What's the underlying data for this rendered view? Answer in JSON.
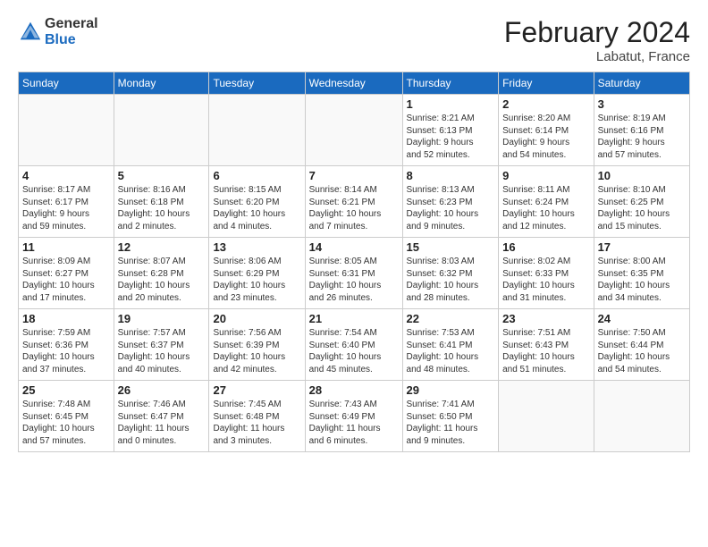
{
  "logo": {
    "general": "General",
    "blue": "Blue"
  },
  "title": "February 2024",
  "location": "Labatut, France",
  "days_header": [
    "Sunday",
    "Monday",
    "Tuesday",
    "Wednesday",
    "Thursday",
    "Friday",
    "Saturday"
  ],
  "weeks": [
    [
      {
        "num": "",
        "info": ""
      },
      {
        "num": "",
        "info": ""
      },
      {
        "num": "",
        "info": ""
      },
      {
        "num": "",
        "info": ""
      },
      {
        "num": "1",
        "info": "Sunrise: 8:21 AM\nSunset: 6:13 PM\nDaylight: 9 hours\nand 52 minutes."
      },
      {
        "num": "2",
        "info": "Sunrise: 8:20 AM\nSunset: 6:14 PM\nDaylight: 9 hours\nand 54 minutes."
      },
      {
        "num": "3",
        "info": "Sunrise: 8:19 AM\nSunset: 6:16 PM\nDaylight: 9 hours\nand 57 minutes."
      }
    ],
    [
      {
        "num": "4",
        "info": "Sunrise: 8:17 AM\nSunset: 6:17 PM\nDaylight: 9 hours\nand 59 minutes."
      },
      {
        "num": "5",
        "info": "Sunrise: 8:16 AM\nSunset: 6:18 PM\nDaylight: 10 hours\nand 2 minutes."
      },
      {
        "num": "6",
        "info": "Sunrise: 8:15 AM\nSunset: 6:20 PM\nDaylight: 10 hours\nand 4 minutes."
      },
      {
        "num": "7",
        "info": "Sunrise: 8:14 AM\nSunset: 6:21 PM\nDaylight: 10 hours\nand 7 minutes."
      },
      {
        "num": "8",
        "info": "Sunrise: 8:13 AM\nSunset: 6:23 PM\nDaylight: 10 hours\nand 9 minutes."
      },
      {
        "num": "9",
        "info": "Sunrise: 8:11 AM\nSunset: 6:24 PM\nDaylight: 10 hours\nand 12 minutes."
      },
      {
        "num": "10",
        "info": "Sunrise: 8:10 AM\nSunset: 6:25 PM\nDaylight: 10 hours\nand 15 minutes."
      }
    ],
    [
      {
        "num": "11",
        "info": "Sunrise: 8:09 AM\nSunset: 6:27 PM\nDaylight: 10 hours\nand 17 minutes."
      },
      {
        "num": "12",
        "info": "Sunrise: 8:07 AM\nSunset: 6:28 PM\nDaylight: 10 hours\nand 20 minutes."
      },
      {
        "num": "13",
        "info": "Sunrise: 8:06 AM\nSunset: 6:29 PM\nDaylight: 10 hours\nand 23 minutes."
      },
      {
        "num": "14",
        "info": "Sunrise: 8:05 AM\nSunset: 6:31 PM\nDaylight: 10 hours\nand 26 minutes."
      },
      {
        "num": "15",
        "info": "Sunrise: 8:03 AM\nSunset: 6:32 PM\nDaylight: 10 hours\nand 28 minutes."
      },
      {
        "num": "16",
        "info": "Sunrise: 8:02 AM\nSunset: 6:33 PM\nDaylight: 10 hours\nand 31 minutes."
      },
      {
        "num": "17",
        "info": "Sunrise: 8:00 AM\nSunset: 6:35 PM\nDaylight: 10 hours\nand 34 minutes."
      }
    ],
    [
      {
        "num": "18",
        "info": "Sunrise: 7:59 AM\nSunset: 6:36 PM\nDaylight: 10 hours\nand 37 minutes."
      },
      {
        "num": "19",
        "info": "Sunrise: 7:57 AM\nSunset: 6:37 PM\nDaylight: 10 hours\nand 40 minutes."
      },
      {
        "num": "20",
        "info": "Sunrise: 7:56 AM\nSunset: 6:39 PM\nDaylight: 10 hours\nand 42 minutes."
      },
      {
        "num": "21",
        "info": "Sunrise: 7:54 AM\nSunset: 6:40 PM\nDaylight: 10 hours\nand 45 minutes."
      },
      {
        "num": "22",
        "info": "Sunrise: 7:53 AM\nSunset: 6:41 PM\nDaylight: 10 hours\nand 48 minutes."
      },
      {
        "num": "23",
        "info": "Sunrise: 7:51 AM\nSunset: 6:43 PM\nDaylight: 10 hours\nand 51 minutes."
      },
      {
        "num": "24",
        "info": "Sunrise: 7:50 AM\nSunset: 6:44 PM\nDaylight: 10 hours\nand 54 minutes."
      }
    ],
    [
      {
        "num": "25",
        "info": "Sunrise: 7:48 AM\nSunset: 6:45 PM\nDaylight: 10 hours\nand 57 minutes."
      },
      {
        "num": "26",
        "info": "Sunrise: 7:46 AM\nSunset: 6:47 PM\nDaylight: 11 hours\nand 0 minutes."
      },
      {
        "num": "27",
        "info": "Sunrise: 7:45 AM\nSunset: 6:48 PM\nDaylight: 11 hours\nand 3 minutes."
      },
      {
        "num": "28",
        "info": "Sunrise: 7:43 AM\nSunset: 6:49 PM\nDaylight: 11 hours\nand 6 minutes."
      },
      {
        "num": "29",
        "info": "Sunrise: 7:41 AM\nSunset: 6:50 PM\nDaylight: 11 hours\nand 9 minutes."
      },
      {
        "num": "",
        "info": ""
      },
      {
        "num": "",
        "info": ""
      }
    ]
  ]
}
